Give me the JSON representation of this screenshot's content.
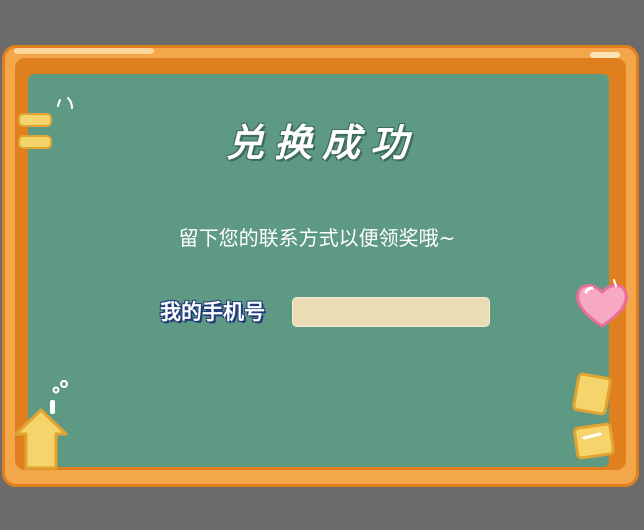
{
  "dialog": {
    "title": "兑换成功",
    "message": "留下您的联系方式以便领奖哦~",
    "phone_label": "我的手机号",
    "phone_value": "",
    "phone_placeholder": ""
  },
  "colors": {
    "background": "#6b6b6b",
    "frame": "#f3a64a",
    "frame_rim": "#e07f1d",
    "board": "#5e9984",
    "input_fill": "#ecdcb5",
    "label_outline": "#1f3b7a"
  },
  "decorations": {
    "icons": [
      "chalk-marks-icon",
      "yellow-bars-icon",
      "heart-icon",
      "sticky-notes-icon",
      "house-icon"
    ]
  }
}
